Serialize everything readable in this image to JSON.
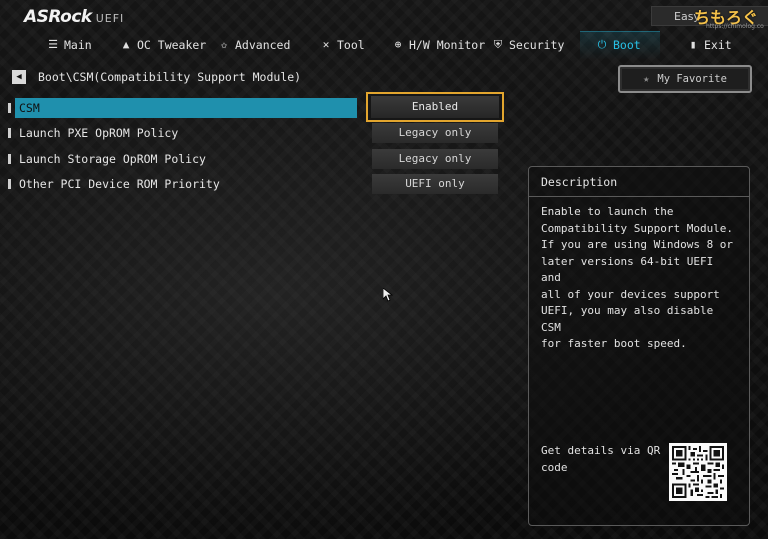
{
  "brand": {
    "name": "ASRock",
    "sub": "UEFI"
  },
  "mode_button": {
    "label": "Easy"
  },
  "watermark": {
    "text": "ちもろぐ",
    "url": "https://chimolog.co"
  },
  "nav": {
    "items": [
      {
        "label": "Main",
        "icon": "list-icon"
      },
      {
        "label": "OC Tweaker",
        "icon": "flame-icon"
      },
      {
        "label": "Advanced",
        "icon": "star-icon"
      },
      {
        "label": "Tool",
        "icon": "tools-icon"
      },
      {
        "label": "H/W Monitor",
        "icon": "monitor-icon"
      },
      {
        "label": "Security",
        "icon": "shield-icon"
      },
      {
        "label": "Boot",
        "icon": "power-icon"
      },
      {
        "label": "Exit",
        "icon": "exit-icon"
      }
    ],
    "active": "Boot",
    "accent_color": "#27c0e6"
  },
  "breadcrumb": "Boot\\CSM(Compatibility Support Module)",
  "favorite_button": {
    "label": "My Favorite"
  },
  "settings": [
    {
      "label": "CSM",
      "value": "Enabled",
      "selected": true
    },
    {
      "label": "Launch PXE OpROM Policy",
      "value": "Legacy only",
      "selected": false
    },
    {
      "label": "Launch Storage OpROM Policy",
      "value": "Legacy only",
      "selected": false
    },
    {
      "label": "Other PCI Device ROM Priority",
      "value": "UEFI only",
      "selected": false
    }
  ],
  "selection_colors": {
    "highlight": "#1f90ad",
    "value_border": "#e2a52e"
  },
  "description": {
    "title": "Description",
    "lines": [
      "Enable to launch the",
      "Compatibility Support Module.",
      "If you are using Windows 8 or",
      "later versions 64-bit UEFI and",
      "all of your devices support",
      "UEFI, you may also disable CSM",
      "for faster boot speed."
    ],
    "qr_lines": [
      "Get details via QR",
      "code"
    ]
  }
}
